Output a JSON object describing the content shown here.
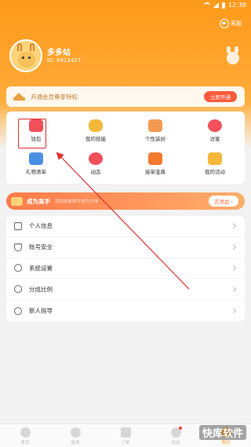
{
  "status_bar": {
    "time": "12:38"
  },
  "header": {
    "service_label": "客服",
    "username": "多多站",
    "user_id": "ID: 6912427"
  },
  "vip": {
    "text": "开通会员尊享特权",
    "button": "立即开通"
  },
  "grid": [
    {
      "label": "钱包",
      "icon": "wallet-icon",
      "color": "#f0505a"
    },
    {
      "label": "我的技能",
      "icon": "gamepad-icon",
      "color": "#f4b93c"
    },
    {
      "label": "个性装扮",
      "icon": "shirt-icon",
      "color": "#f39a52"
    },
    {
      "label": "访客",
      "icon": "visitor-icon",
      "color": "#f0505a"
    },
    {
      "label": "礼物清单",
      "icon": "gift-icon",
      "color": "#4a90e2"
    },
    {
      "label": "动态",
      "icon": "star-icon",
      "color": "#f0505a"
    },
    {
      "label": "接单宝典",
      "icon": "book-icon",
      "color": "#f37a2e"
    },
    {
      "label": "我的活动",
      "icon": "activity-icon",
      "color": "#f4b93c"
    }
  ],
  "promo": {
    "title": "成为高手",
    "subtitle": "添加技能即可成为大神",
    "button": "去添加 ›"
  },
  "menu": [
    {
      "label": "个人信息",
      "icon": "edit-icon"
    },
    {
      "label": "账号安全",
      "icon": "shield-icon"
    },
    {
      "label": "系统设置",
      "icon": "gear-icon"
    },
    {
      "label": "分成比例",
      "icon": "pie-chart-icon"
    },
    {
      "label": "新人指导",
      "icon": "help-icon"
    }
  ],
  "bottom_nav": [
    {
      "label": "首页",
      "icon": "home-icon"
    },
    {
      "label": "星球",
      "icon": "planet-icon"
    },
    {
      "label": "订单",
      "icon": "order-icon"
    },
    {
      "label": "消息",
      "icon": "bell-icon"
    },
    {
      "label": "我的",
      "icon": "profile-icon"
    }
  ],
  "watermark": "快库软件"
}
